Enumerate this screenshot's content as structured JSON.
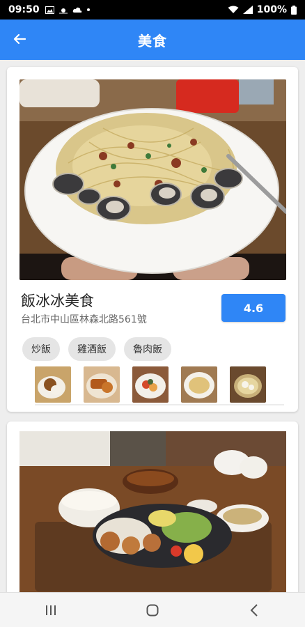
{
  "status_bar": {
    "time": "09:50",
    "battery": "100%",
    "left_icons": [
      "image-icon",
      "weather-icon",
      "cloud-icon",
      "dot-icon"
    ],
    "right_icons": [
      "wifi-icon",
      "signal-icon",
      "battery-icon"
    ]
  },
  "app_bar": {
    "title": "美食",
    "back_icon": "arrow-left-icon",
    "color": "#2f86f6"
  },
  "restaurants": [
    {
      "name": "飯冰冰美食",
      "address": "台北市中山區林森北路561號",
      "rating": "4.6",
      "tags": [
        "炒飯",
        "雞酒飯",
        "魯肉飯"
      ],
      "thumbnails": [
        "dish-photo-1",
        "dish-photo-2",
        "dish-photo-3",
        "dish-photo-4",
        "dish-photo-5"
      ]
    },
    {
      "name": "",
      "photo": "set-meal-photo"
    }
  ],
  "nav_bar": {
    "buttons": [
      "recent-apps-icon",
      "home-icon",
      "back-icon"
    ]
  }
}
